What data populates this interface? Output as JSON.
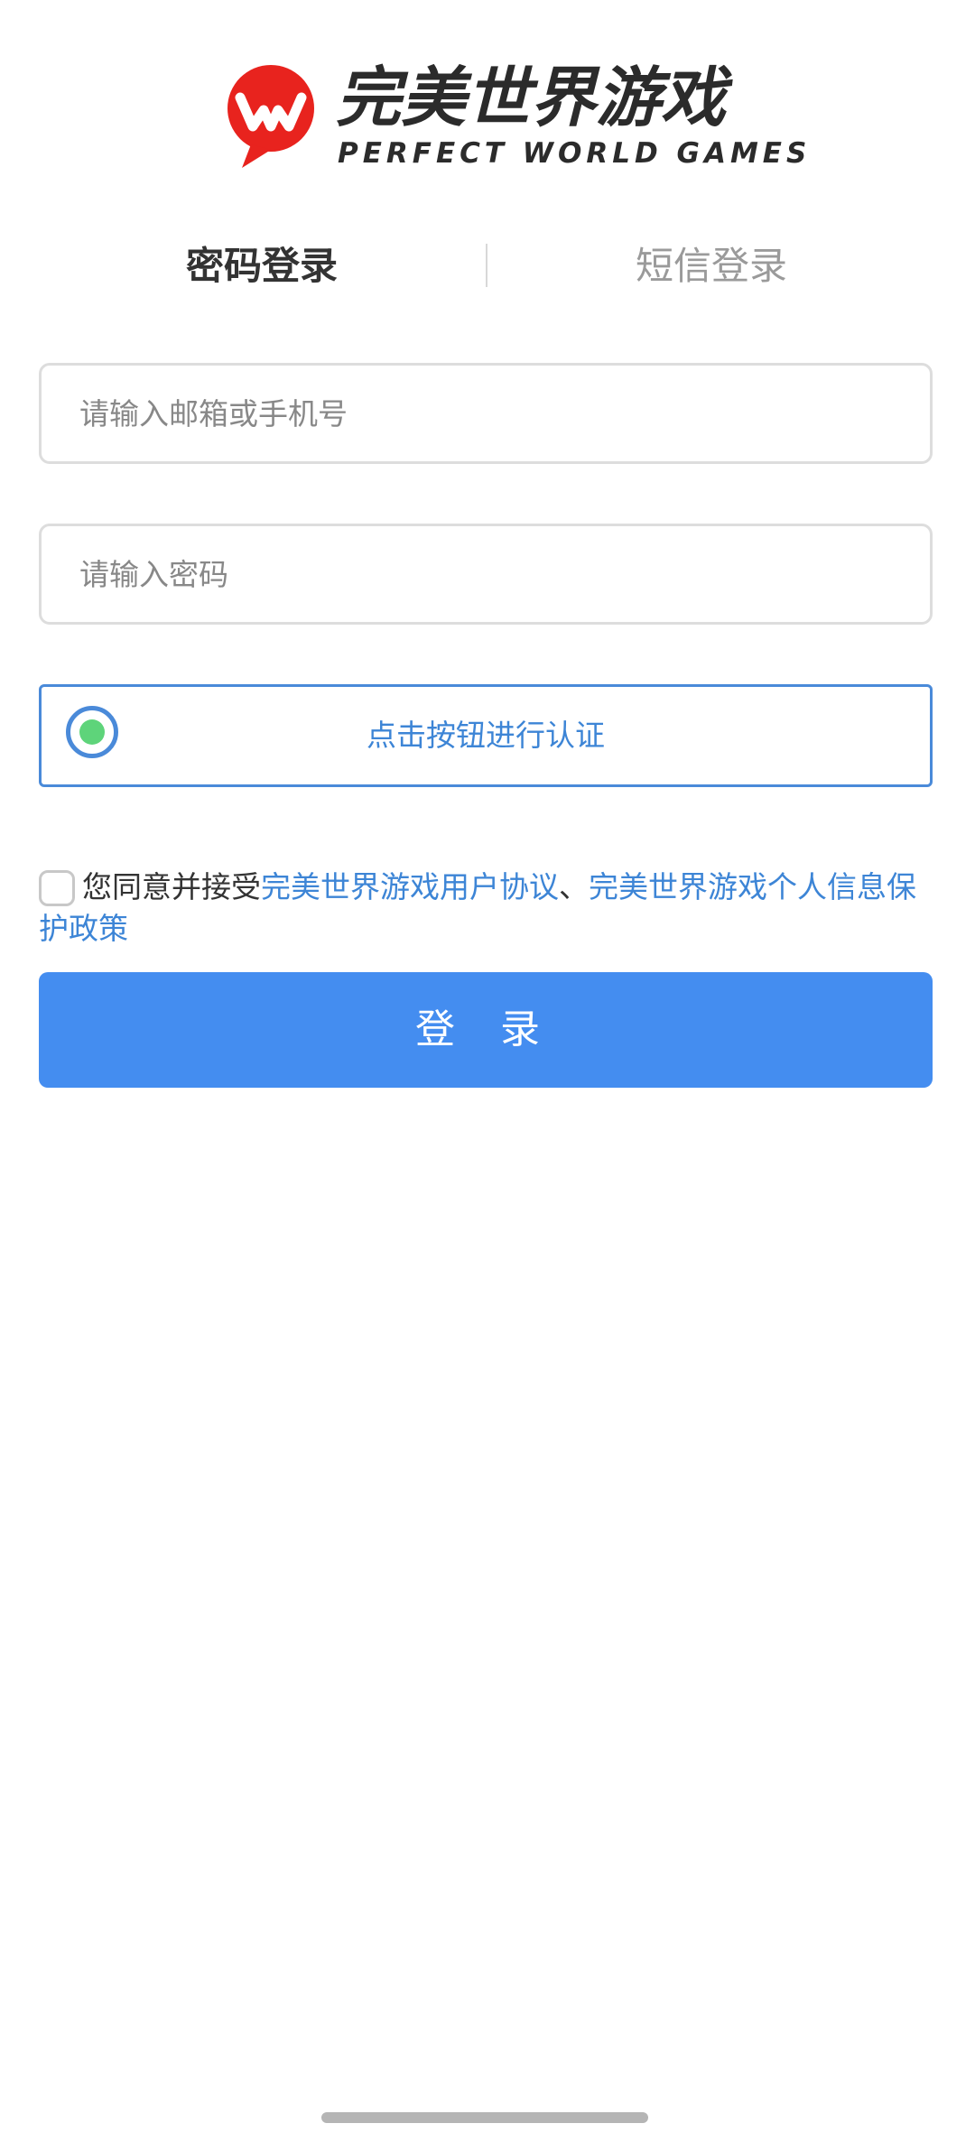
{
  "logo": {
    "name_cn": "完美世界游戏",
    "name_en": "PERFECT WORLD GAMES",
    "colors": {
      "brand_red": "#e8231e",
      "text_dark": "#2b2b2b"
    }
  },
  "tabs": [
    {
      "label": "密码登录",
      "active": true
    },
    {
      "label": "短信登录",
      "active": false
    }
  ],
  "form": {
    "account_placeholder": "请输入邮箱或手机号",
    "account_value": "",
    "password_placeholder": "请输入密码",
    "password_value": "",
    "verify_label": "点击按钮进行认证"
  },
  "agreement": {
    "checked": false,
    "prefix": "您同意并接受",
    "user_agreement": "完美世界游戏用户协议",
    "separator": "、",
    "privacy_policy": "完美世界游戏个人信息保护政策"
  },
  "login_button": "登 录",
  "colors": {
    "primary_blue": "#448df0",
    "link_blue": "#3d85d6",
    "verify_green": "#5ed47a"
  }
}
